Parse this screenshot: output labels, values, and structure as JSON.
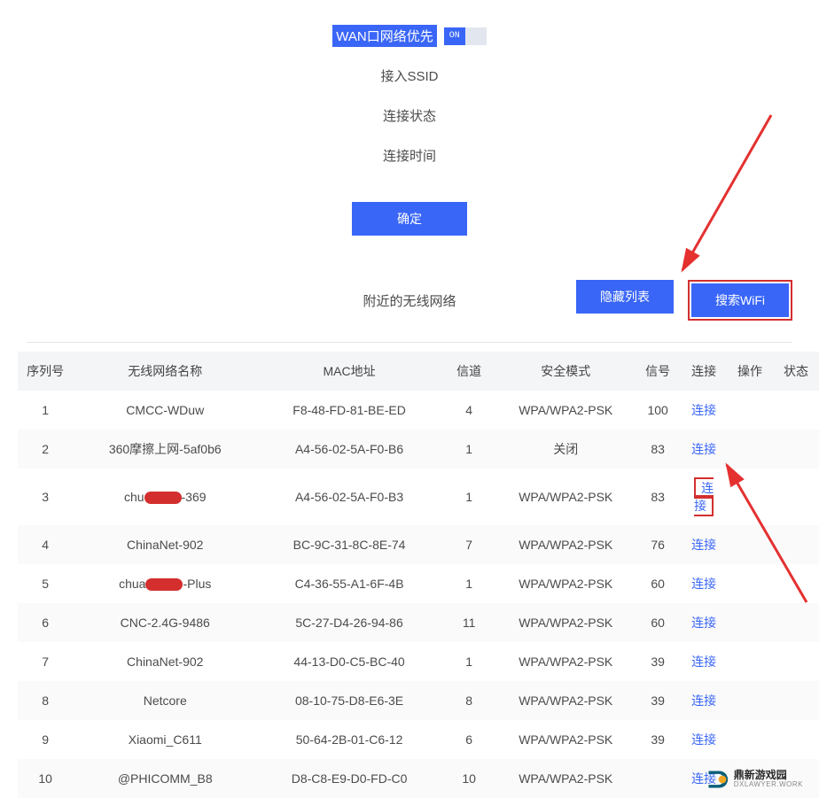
{
  "settings": {
    "wan_priority_label": "WAN口网络优先",
    "toggle_text": "ON",
    "ssid_label": "接入SSID",
    "conn_status_label": "连接状态",
    "conn_time_label": "连接时间",
    "confirm_label": "确定"
  },
  "list_header": {
    "title": "附近的无线网络",
    "hide_label": "隐藏列表",
    "search_label": "搜索WiFi"
  },
  "columns": {
    "index": "序列号",
    "name": "无线网络名称",
    "mac": "MAC地址",
    "channel": "信道",
    "security": "安全模式",
    "signal": "信号",
    "connect": "连接",
    "operate": "操作",
    "status": "状态"
  },
  "connect_action": "连接",
  "rows": [
    {
      "idx": "1",
      "name": "CMCC-WDuw",
      "redacted": false,
      "suffix": "",
      "mac": "F8-48-FD-81-BE-ED",
      "ch": "4",
      "sec": "WPA/WPA2-PSK",
      "sig": "100",
      "boxed": false
    },
    {
      "idx": "2",
      "name": "360摩擦上网-5af0b6",
      "redacted": false,
      "suffix": "",
      "mac": "A4-56-02-5A-F0-B6",
      "ch": "1",
      "sec": "关闭",
      "sig": "83",
      "boxed": false
    },
    {
      "idx": "3",
      "name": "chu",
      "redacted": true,
      "suffix": "-369",
      "mac": "A4-56-02-5A-F0-B3",
      "ch": "1",
      "sec": "WPA/WPA2-PSK",
      "sig": "83",
      "boxed": true
    },
    {
      "idx": "4",
      "name": "ChinaNet-902",
      "redacted": false,
      "suffix": "",
      "mac": "BC-9C-31-8C-8E-74",
      "ch": "7",
      "sec": "WPA/WPA2-PSK",
      "sig": "76",
      "boxed": false
    },
    {
      "idx": "5",
      "name": "chua",
      "redacted": true,
      "suffix": "-Plus",
      "mac": "C4-36-55-A1-6F-4B",
      "ch": "1",
      "sec": "WPA/WPA2-PSK",
      "sig": "60",
      "boxed": false
    },
    {
      "idx": "6",
      "name": "CNC-2.4G-9486",
      "redacted": false,
      "suffix": "",
      "mac": "5C-27-D4-26-94-86",
      "ch": "11",
      "sec": "WPA/WPA2-PSK",
      "sig": "60",
      "boxed": false
    },
    {
      "idx": "7",
      "name": "ChinaNet-902",
      "redacted": false,
      "suffix": "",
      "mac": "44-13-D0-C5-BC-40",
      "ch": "1",
      "sec": "WPA/WPA2-PSK",
      "sig": "39",
      "boxed": false
    },
    {
      "idx": "8",
      "name": "Netcore",
      "redacted": false,
      "suffix": "",
      "mac": "08-10-75-D8-E6-3E",
      "ch": "8",
      "sec": "WPA/WPA2-PSK",
      "sig": "39",
      "boxed": false
    },
    {
      "idx": "9",
      "name": "Xiaomi_C611",
      "redacted": false,
      "suffix": "",
      "mac": "50-64-2B-01-C6-12",
      "ch": "6",
      "sec": "WPA/WPA2-PSK",
      "sig": "39",
      "boxed": false
    },
    {
      "idx": "10",
      "name": "@PHICOMM_B8",
      "redacted": false,
      "suffix": "",
      "mac": "D8-C8-E9-D0-FD-C0",
      "ch": "10",
      "sec": "WPA/WPA2-PSK",
      "sig": "",
      "boxed": false
    }
  ],
  "watermark": {
    "title": "鼎新游戏园",
    "sub": "DXLAWYER.WORK"
  }
}
